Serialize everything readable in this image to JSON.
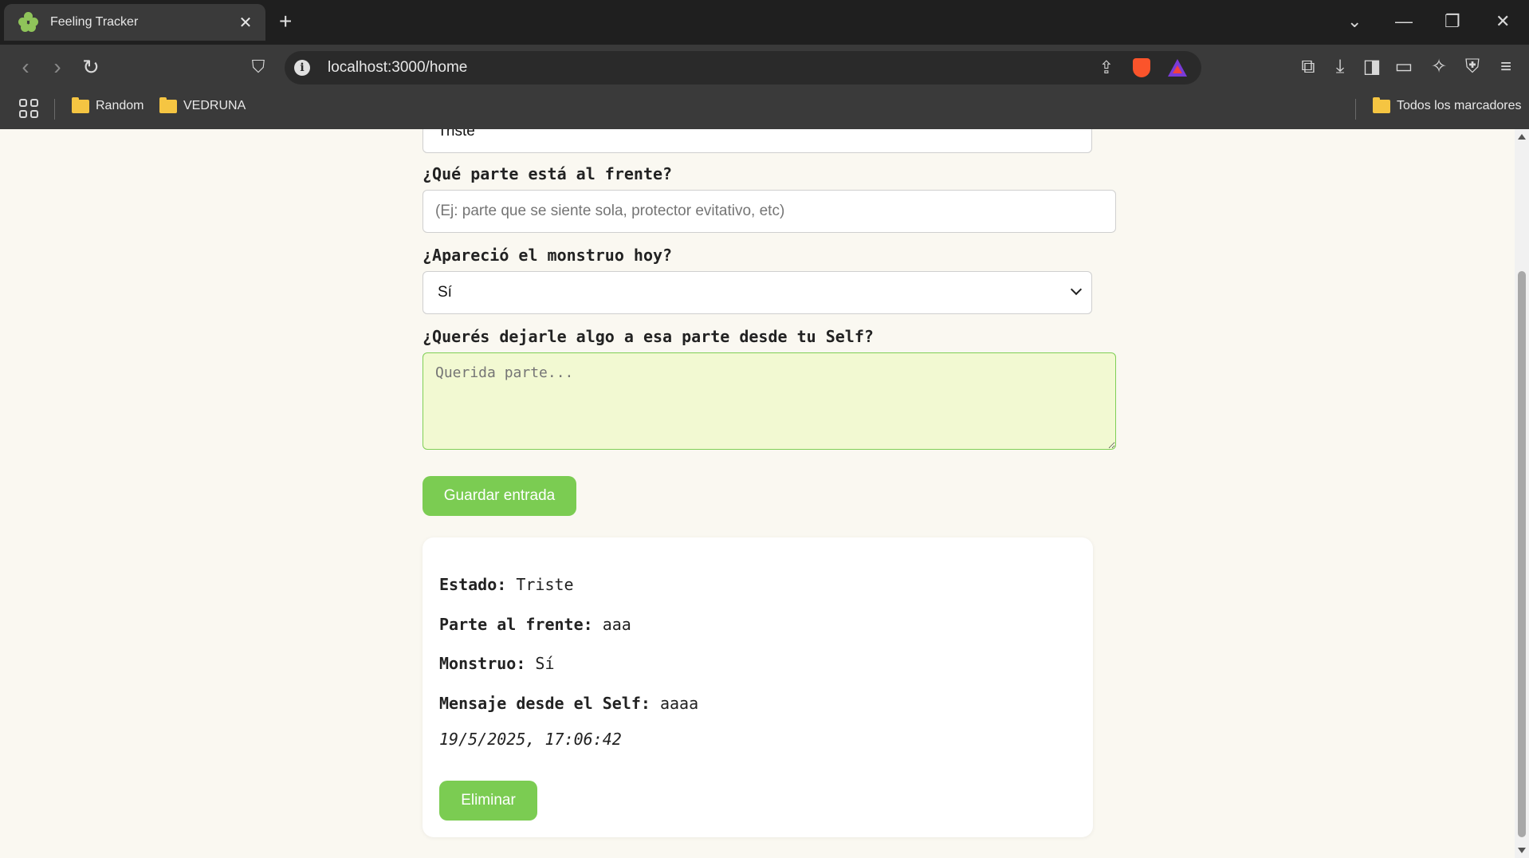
{
  "browser": {
    "tab_title": "Feeling Tracker",
    "url": "localhost:3000/home",
    "bookmarks": [
      "Random",
      "VEDRUNA"
    ],
    "all_bookmarks_label": "Todos los marcadores"
  },
  "form": {
    "state_selected": "Triste",
    "front_part_label": "¿Qué parte está al frente?",
    "front_part_placeholder": "(Ej: parte que se siente sola, protector evitativo, etc)",
    "monster_label": "¿Apareció el monstruo hoy?",
    "monster_selected": "Sí",
    "self_message_label": "¿Querés dejarle algo a esa parte desde tu Self?",
    "self_message_placeholder": "Querida parte...",
    "save_button": "Guardar entrada"
  },
  "entry": {
    "state_label": "Estado:",
    "state_value": "Triste",
    "front_label": "Parte al frente:",
    "front_value": "aaa",
    "monster_label": "Monstruo:",
    "monster_value": "Sí",
    "message_label": "Mensaje desde el Self:",
    "message_value": "aaaa",
    "date": "19/5/2025, 17:06:42",
    "delete_button": "Eliminar"
  },
  "colors": {
    "accent_green": "#7bcc52",
    "textarea_bg": "#f2f9d2",
    "page_bg": "#faf8f1"
  }
}
